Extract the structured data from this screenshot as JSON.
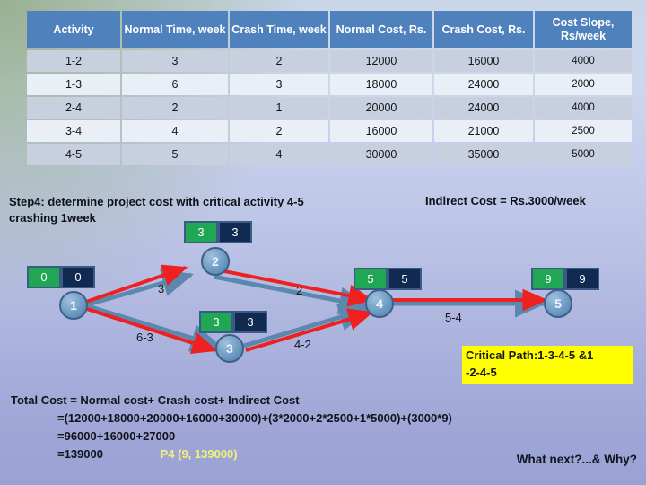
{
  "table": {
    "headers": [
      "Activity",
      "Normal Time, week",
      "Crash Time, week",
      "Normal Cost, Rs.",
      "Crash Cost, Rs.",
      "Cost Slope, Rs/week"
    ],
    "rows": [
      {
        "activity": "1-2",
        "normal_time": "3",
        "crash_time": "2",
        "normal_cost": "12000",
        "crash_cost": "16000",
        "cost_slope": "4000"
      },
      {
        "activity": "1-3",
        "normal_time": "6",
        "crash_time": "3",
        "normal_cost": "18000",
        "crash_cost": "24000",
        "cost_slope": "2000"
      },
      {
        "activity": "2-4",
        "normal_time": "2",
        "crash_time": "1",
        "normal_cost": "20000",
        "crash_cost": "24000",
        "cost_slope": "4000"
      },
      {
        "activity": "3-4",
        "normal_time": "4",
        "crash_time": "2",
        "normal_cost": "16000",
        "crash_cost": "21000",
        "cost_slope": "2500"
      },
      {
        "activity": "4-5",
        "normal_time": "5",
        "crash_time": "4",
        "normal_cost": "30000",
        "crash_cost": "35000",
        "cost_slope": "5000"
      }
    ]
  },
  "step": {
    "line1": "Step4: determine project cost with critical activity 4-5",
    "line2": "crashing 1week"
  },
  "indirect_cost": "Indirect Cost = Rs.3000/week",
  "network": {
    "nodes": [
      {
        "id": "1",
        "label": "1",
        "early": "0",
        "late": "0"
      },
      {
        "id": "2",
        "label": "2",
        "early": "3",
        "late": "3"
      },
      {
        "id": "3",
        "label": "3",
        "early": "3",
        "late": "3"
      },
      {
        "id": "4",
        "label": "4",
        "early": "5",
        "late": "5"
      },
      {
        "id": "5",
        "label": "5",
        "early": "9",
        "late": "9"
      }
    ],
    "edge_labels": {
      "e12": "3",
      "e13": "6-3",
      "e24": "2",
      "e34": "4-2",
      "e45": "5-4"
    }
  },
  "critical_path": {
    "line1": "Critical Path:1-3-4-5 &1",
    "line2": "-2-4-5"
  },
  "calculation": {
    "line1": "Total Cost = Normal cost+  Crash cost+ Indirect Cost",
    "line2": "=(12000+18000+20000+16000+30000)+(3*2000+2*2500+1*5000)+(3000*9)",
    "line3": "=96000+16000+27000",
    "line4": "=139000",
    "point_label": "P4 (9, 139000)"
  },
  "what_next": "What next?...&  Why?",
  "colors": {
    "header_blue": "#4f81bd",
    "row_dark": "#c8cfdf",
    "row_light": "#eaeef6",
    "green_box": "#1fa754",
    "navy_box": "#102a52",
    "critical_red": "#ee2020",
    "normal_edge_blue": "#5c87ae",
    "highlight_yellow": "#ffff00"
  }
}
